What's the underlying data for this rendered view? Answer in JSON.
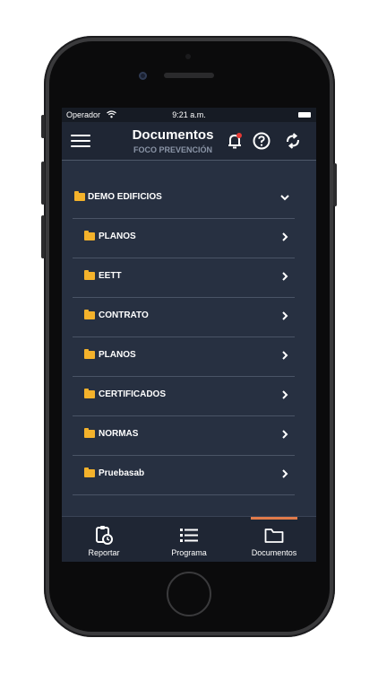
{
  "status_bar": {
    "carrier": "Operador",
    "time": "9:21 a.m."
  },
  "header": {
    "title": "Documentos",
    "subtitle": "FOCO PREVENCIÓN",
    "icons": [
      "menu-icon",
      "bell-icon",
      "help-icon",
      "refresh-icon"
    ],
    "notification_dot_color": "#e53935"
  },
  "folders": {
    "root": {
      "label": "DEMO EDIFICIOS",
      "expanded": true
    },
    "items": [
      {
        "label": "PLANOS"
      },
      {
        "label": "EETT"
      },
      {
        "label": "CONTRATO"
      },
      {
        "label": "PLANOS"
      },
      {
        "label": "CERTIFICADOS"
      },
      {
        "label": "NORMAS"
      },
      {
        "label": "Pruebasab"
      }
    ]
  },
  "tabs": [
    {
      "label": "Reportar",
      "icon": "clipboard-clock-icon",
      "active": false
    },
    {
      "label": "Programa",
      "icon": "list-icon",
      "active": false
    },
    {
      "label": "Documentos",
      "icon": "folder-icon",
      "active": true
    }
  ],
  "colors": {
    "background": "#273041",
    "folder": "#f4b22b",
    "accent": "#e07a4a"
  }
}
